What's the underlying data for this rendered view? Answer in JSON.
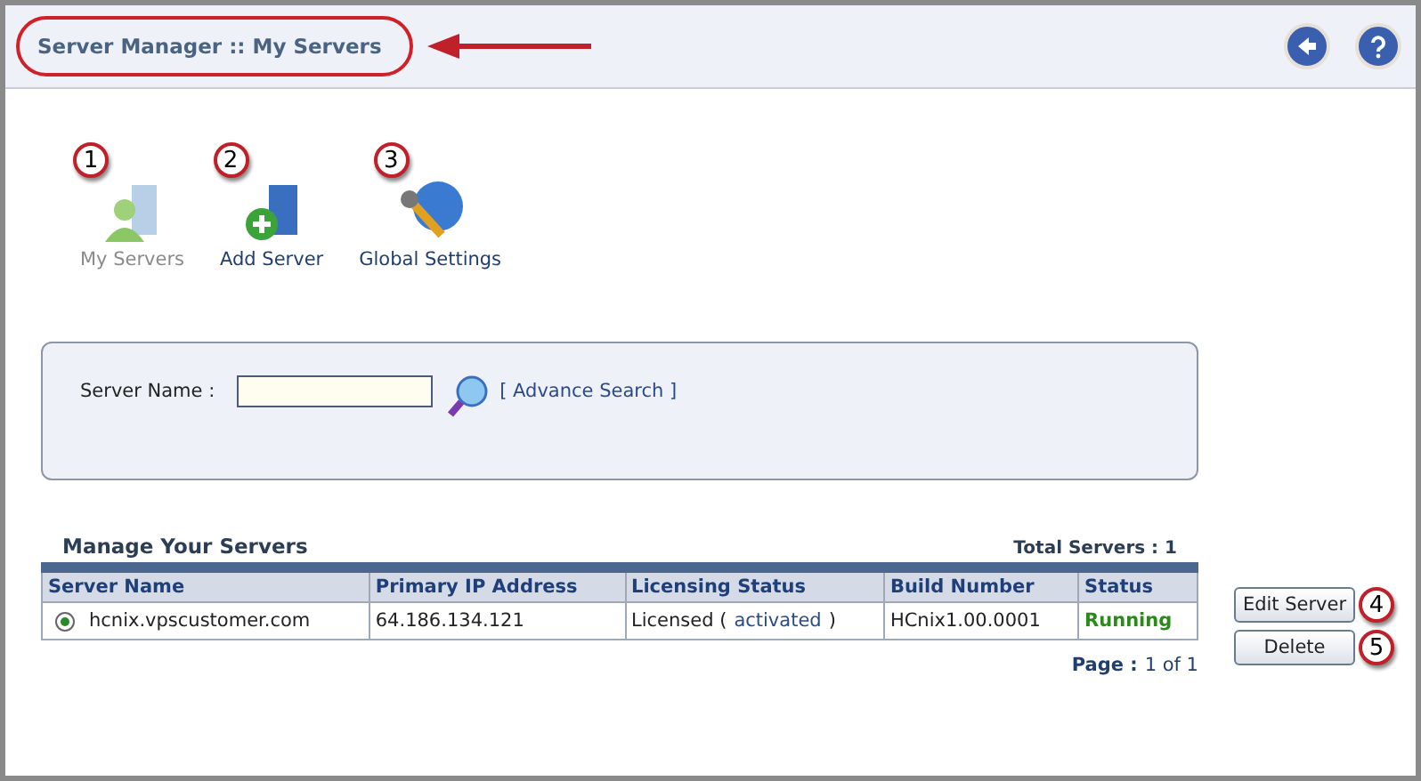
{
  "header": {
    "title": "Server Manager :: My Servers"
  },
  "nav": [
    {
      "label": "My Servers",
      "callout": "1",
      "selected": true,
      "kind": "servers"
    },
    {
      "label": "Add Server",
      "callout": "2",
      "selected": false,
      "kind": "add"
    },
    {
      "label": "Global Settings",
      "callout": "3",
      "selected": false,
      "kind": "settings"
    }
  ],
  "search": {
    "label": "Server Name :",
    "link": "[ Advance Search ]"
  },
  "table": {
    "title": "Manage Your Servers",
    "total": "Total Servers : 1",
    "columns": [
      "Server Name",
      "Primary IP Address",
      "Licensing Status",
      "Build Number",
      "Status"
    ],
    "rows": [
      {
        "selected": true,
        "name": "hcnix.vpscustomer.com",
        "ip": "64.186.134.121",
        "license": "Licensed (",
        "activation": "activated",
        "license_end": ")",
        "build": "HCnix1.00.0001",
        "status": "Running"
      }
    ]
  },
  "pager": {
    "label": "Page :",
    "value": "1 of 1"
  },
  "buttons": [
    {
      "label": "Edit Server",
      "callout": "4"
    },
    {
      "label": "Delete",
      "callout": "5"
    }
  ]
}
